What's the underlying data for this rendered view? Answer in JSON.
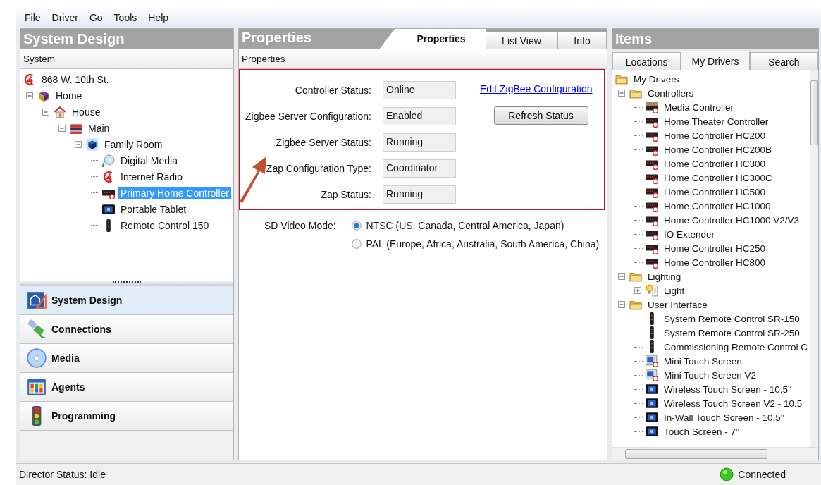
{
  "menu": [
    "File",
    "Driver",
    "Go",
    "Tools",
    "Help"
  ],
  "system_design": {
    "title": "System Design",
    "subtitle": "System",
    "tree": [
      {
        "label": "868 W. 10th St.",
        "kind": "logo",
        "selected": false,
        "children": [
          {
            "label": "Home",
            "kind": "home",
            "expanded": true,
            "selected": false,
            "children": [
              {
                "label": "House",
                "kind": "house",
                "expanded": true,
                "selected": false,
                "children": [
                  {
                    "label": "Main",
                    "kind": "floor",
                    "expanded": true,
                    "selected": false,
                    "children": [
                      {
                        "label": "Family Room",
                        "kind": "room",
                        "expanded": true,
                        "selected": false,
                        "children": [
                          {
                            "label": "Digital Media",
                            "kind": "media",
                            "selected": false
                          },
                          {
                            "label": "Internet Radio",
                            "kind": "logo",
                            "selected": false
                          },
                          {
                            "label": "Primary Home Controller",
                            "kind": "controller",
                            "selected": true
                          },
                          {
                            "label": "Portable Tablet",
                            "kind": "tablet",
                            "selected": false
                          },
                          {
                            "label": "Remote Control 150",
                            "kind": "remote",
                            "selected": false
                          }
                        ]
                      }
                    ]
                  }
                ]
              }
            ]
          }
        ]
      }
    ],
    "nav": [
      {
        "label": "System Design",
        "kind": "design",
        "selected": true
      },
      {
        "label": "Connections",
        "kind": "connections",
        "selected": false
      },
      {
        "label": "Media",
        "kind": "media",
        "selected": false
      },
      {
        "label": "Agents",
        "kind": "agents",
        "selected": false
      },
      {
        "label": "Programming",
        "kind": "programming",
        "selected": false
      }
    ]
  },
  "properties": {
    "title": "Properties",
    "tabs": [
      {
        "label": "Properties",
        "selected": true
      },
      {
        "label": "List View",
        "selected": false
      },
      {
        "label": "Info",
        "selected": false
      }
    ],
    "subtitle": "Properties",
    "fields": [
      {
        "label": "Controller Status:",
        "value": "Online"
      },
      {
        "label": "Zigbee Server Configuration:",
        "value": "Enabled"
      },
      {
        "label": "Zigbee Server Status:",
        "value": "Running"
      },
      {
        "label": "Zap Configuration Type:",
        "value": "Coordinator"
      },
      {
        "label": "Zap Status:",
        "value": "Running"
      }
    ],
    "link": "Edit ZigBee Configuration",
    "button": "Refresh Status",
    "video_mode": {
      "label": "SD Video Mode:",
      "options": [
        {
          "label": "NTSC (US, Canada, Central America, Japan)",
          "selected": true
        },
        {
          "label": "PAL (Europe, Africa, Australia, South America, China)",
          "selected": false
        }
      ]
    }
  },
  "items": {
    "title": "Items",
    "tabs": [
      {
        "label": "Locations",
        "selected": false
      },
      {
        "label": "My Drivers",
        "selected": true
      },
      {
        "label": "Search",
        "selected": false
      }
    ],
    "tree": [
      {
        "label": "My Drivers",
        "kind": "folder",
        "selected": false,
        "children": [
          {
            "label": "Controllers",
            "kind": "folder",
            "expanded": true,
            "selected": false,
            "children": [
              {
                "label": "Media Controller",
                "kind": "mediacontroller",
                "selected": false
              },
              {
                "label": "Home Theater Controller",
                "kind": "controller",
                "selected": false
              },
              {
                "label": "Home Controller HC200",
                "kind": "controller",
                "selected": false
              },
              {
                "label": "Home Controller HC200B",
                "kind": "controller",
                "selected": false
              },
              {
                "label": "Home Controller HC300",
                "kind": "controller",
                "selected": false
              },
              {
                "label": "Home Controller HC300C",
                "kind": "controller",
                "selected": false
              },
              {
                "label": "Home Controller HC500",
                "kind": "controller",
                "selected": false
              },
              {
                "label": "Home Controller HC1000",
                "kind": "controller",
                "selected": false
              },
              {
                "label": "Home Controller HC1000 V2/V3",
                "kind": "controller",
                "selected": false
              },
              {
                "label": "IO Extender",
                "kind": "controller",
                "selected": false
              },
              {
                "label": "Home Controller HC250",
                "kind": "controller",
                "selected": false
              },
              {
                "label": "Home Controller HC800",
                "kind": "controller",
                "selected": false
              }
            ]
          },
          {
            "label": "Lighting",
            "kind": "folder",
            "expanded": true,
            "selected": false,
            "children": [
              {
                "label": "Light",
                "kind": "light",
                "expanded": false,
                "selected": false
              }
            ]
          },
          {
            "label": "User Interface",
            "kind": "folder",
            "expanded": true,
            "selected": false,
            "children": [
              {
                "label": "System Remote Control SR-150",
                "kind": "remote",
                "selected": false
              },
              {
                "label": "System Remote Control SR-250",
                "kind": "remote",
                "selected": false
              },
              {
                "label": "Commissioning Remote Control C",
                "kind": "remote",
                "selected": false
              },
              {
                "label": "Mini Touch Screen",
                "kind": "minitouch",
                "selected": false
              },
              {
                "label": "Mini Touch Screen V2",
                "kind": "minitouch",
                "selected": false
              },
              {
                "label": "Wireless Touch Screen - 10.5''",
                "kind": "tablet",
                "selected": false
              },
              {
                "label": "Wireless Touch Screen V2 - 10.5",
                "kind": "tablet",
                "selected": false
              },
              {
                "label": "In-Wall Touch Screen - 10.5''",
                "kind": "tablet",
                "selected": false
              },
              {
                "label": "Touch Screen - 7''",
                "kind": "tablet",
                "selected": false
              }
            ]
          }
        ]
      }
    ]
  },
  "status_bar": {
    "left": "Director Status: Idle",
    "right": "Connected",
    "connected": true
  }
}
